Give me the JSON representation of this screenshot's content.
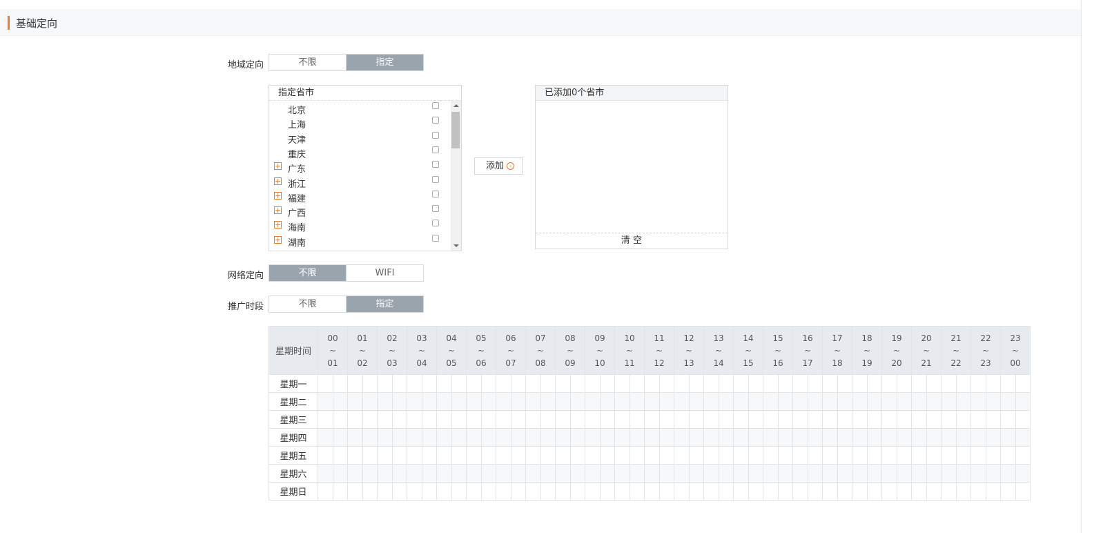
{
  "section": {
    "title": "基础定向"
  },
  "region": {
    "label": "地域定向",
    "options": [
      "不限",
      "指定"
    ],
    "active_index": 1,
    "list_header": "指定省市",
    "provinces": [
      {
        "name": "北京",
        "expandable": false
      },
      {
        "name": "上海",
        "expandable": false
      },
      {
        "name": "天津",
        "expandable": false
      },
      {
        "name": "重庆",
        "expandable": false
      },
      {
        "name": "广东",
        "expandable": true
      },
      {
        "name": "浙江",
        "expandable": true
      },
      {
        "name": "福建",
        "expandable": true
      },
      {
        "name": "广西",
        "expandable": true
      },
      {
        "name": "海南",
        "expandable": true
      },
      {
        "name": "湖南",
        "expandable": true
      }
    ],
    "add_button": "添加",
    "selected_header": "已添加0个省市",
    "clear_button": "清 空"
  },
  "network": {
    "label": "网络定向",
    "options": [
      "不限",
      "WIFI"
    ],
    "active_index": 0
  },
  "period": {
    "label": "推广时段",
    "options": [
      "不限",
      "指定"
    ],
    "active_index": 1,
    "corner": "星期时间",
    "hours": [
      [
        "00",
        "~",
        "01"
      ],
      [
        "01",
        "~",
        "02"
      ],
      [
        "02",
        "~",
        "03"
      ],
      [
        "03",
        "~",
        "04"
      ],
      [
        "04",
        "~",
        "05"
      ],
      [
        "05",
        "~",
        "06"
      ],
      [
        "06",
        "~",
        "07"
      ],
      [
        "07",
        "~",
        "08"
      ],
      [
        "08",
        "~",
        "09"
      ],
      [
        "09",
        "~",
        "10"
      ],
      [
        "10",
        "~",
        "11"
      ],
      [
        "11",
        "~",
        "12"
      ],
      [
        "12",
        "~",
        "13"
      ],
      [
        "13",
        "~",
        "14"
      ],
      [
        "14",
        "~",
        "15"
      ],
      [
        "15",
        "~",
        "16"
      ],
      [
        "16",
        "~",
        "17"
      ],
      [
        "17",
        "~",
        "18"
      ],
      [
        "18",
        "~",
        "19"
      ],
      [
        "19",
        "~",
        "20"
      ],
      [
        "20",
        "~",
        "21"
      ],
      [
        "21",
        "~",
        "22"
      ],
      [
        "22",
        "~",
        "23"
      ],
      [
        "23",
        "~",
        "00"
      ]
    ],
    "days": [
      "星期一",
      "星期二",
      "星期三",
      "星期四",
      "星期五",
      "星期六",
      "星期日"
    ]
  }
}
